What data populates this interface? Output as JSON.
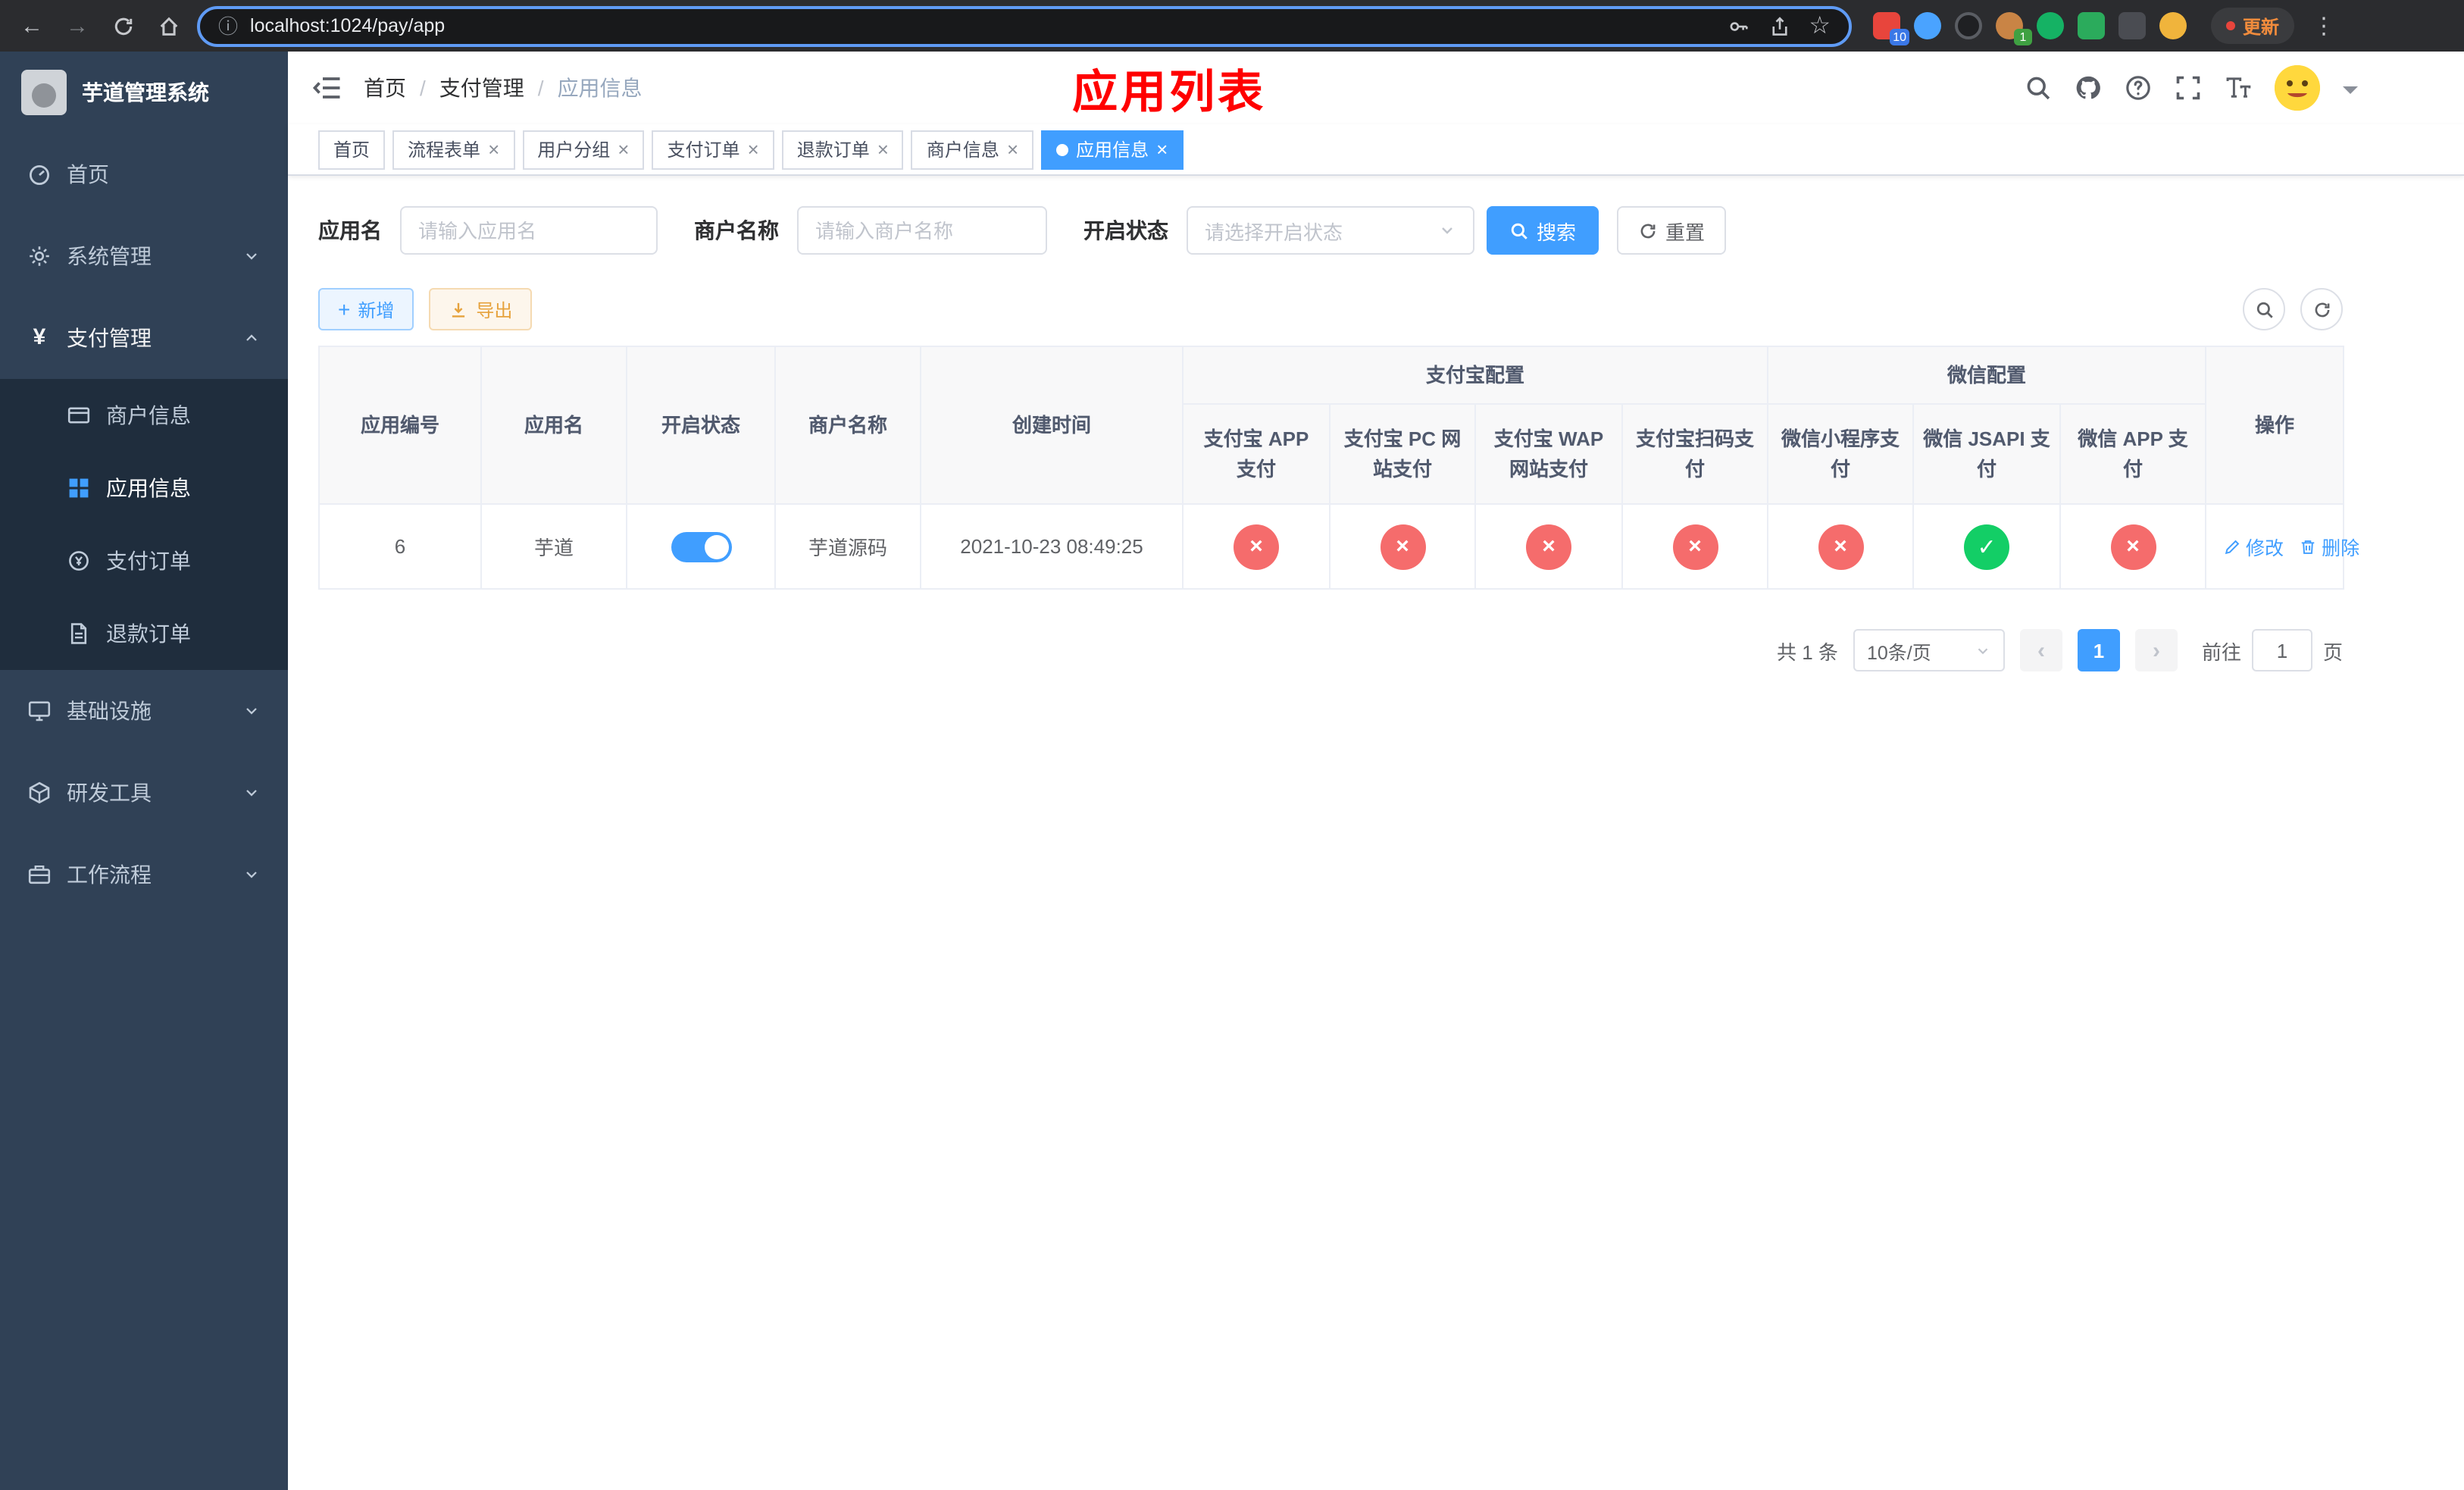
{
  "colors": {
    "accent": "#409eff",
    "danger": "#f56c6c",
    "success": "#13ce66",
    "warning": "#e6a23c",
    "title_red": "#ff0000",
    "sidebar_bg": "#304156",
    "submenu_bg": "#1f2d3d"
  },
  "browser": {
    "url": "localhost:1024/pay/app",
    "update_label": "更新",
    "ext_badge_first": "10",
    "ext_badge_avatar": "1"
  },
  "sidebar": {
    "title": "芋道管理系统",
    "items": {
      "home": "首页",
      "system": "系统管理",
      "pay": "支付管理",
      "merchant": "商户信息",
      "app": "应用信息",
      "order": "支付订单",
      "refund": "退款订单",
      "infra": "基础设施",
      "devtools": "研发工具",
      "workflow": "工作流程"
    }
  },
  "header": {
    "breadcrumb": {
      "home": "首页",
      "pay": "支付管理",
      "app": "应用信息"
    },
    "title": "应用列表"
  },
  "tabs": [
    {
      "label": "首页",
      "closable": false,
      "active": false
    },
    {
      "label": "流程表单",
      "closable": true,
      "active": false
    },
    {
      "label": "用户分组",
      "closable": true,
      "active": false
    },
    {
      "label": "支付订单",
      "closable": true,
      "active": false
    },
    {
      "label": "退款订单",
      "closable": true,
      "active": false
    },
    {
      "label": "商户信息",
      "closable": true,
      "active": false
    },
    {
      "label": "应用信息",
      "closable": true,
      "active": true
    }
  ],
  "filter": {
    "app_name_label": "应用名",
    "app_name_placeholder": "请输入应用名",
    "merchant_label": "商户名称",
    "merchant_placeholder": "请输入商户名称",
    "status_label": "开启状态",
    "status_placeholder": "请选择开启状态",
    "search": "搜索",
    "reset": "重置"
  },
  "toolbar": {
    "add": "新增",
    "export": "导出"
  },
  "table": {
    "groups": {
      "alipay": "支付宝配置",
      "wechat": "微信配置"
    },
    "cols": {
      "id": "应用编号",
      "name": "应用名",
      "status": "开启状态",
      "merchant": "商户名称",
      "created": "创建时间",
      "alipay_app": "支付宝 APP 支付",
      "alipay_pc": "支付宝 PC 网站支付",
      "alipay_wap": "支付宝 WAP 网站支付",
      "alipay_qr": "支付宝扫码支付",
      "wx_lite": "微信小程序支付",
      "wx_jsapi": "微信 JSAPI 支付",
      "wx_app": "微信 APP 支付",
      "actions": "操作"
    },
    "row": {
      "id": "6",
      "name": "芋道",
      "status_on": true,
      "merchant": "芋道源码",
      "created": "2021-10-23 08:49:25",
      "configs": {
        "alipay_app": false,
        "alipay_pc": false,
        "alipay_wap": false,
        "alipay_qr": false,
        "wx_lite": false,
        "wx_jsapi": true,
        "wx_app": false
      },
      "edit": "修改",
      "delete": "删除"
    }
  },
  "pagination": {
    "total": "共 1 条",
    "page_size": "10条/页",
    "page": "1",
    "goto_prefix": "前往",
    "goto_value": "1",
    "goto_suffix": "页"
  }
}
